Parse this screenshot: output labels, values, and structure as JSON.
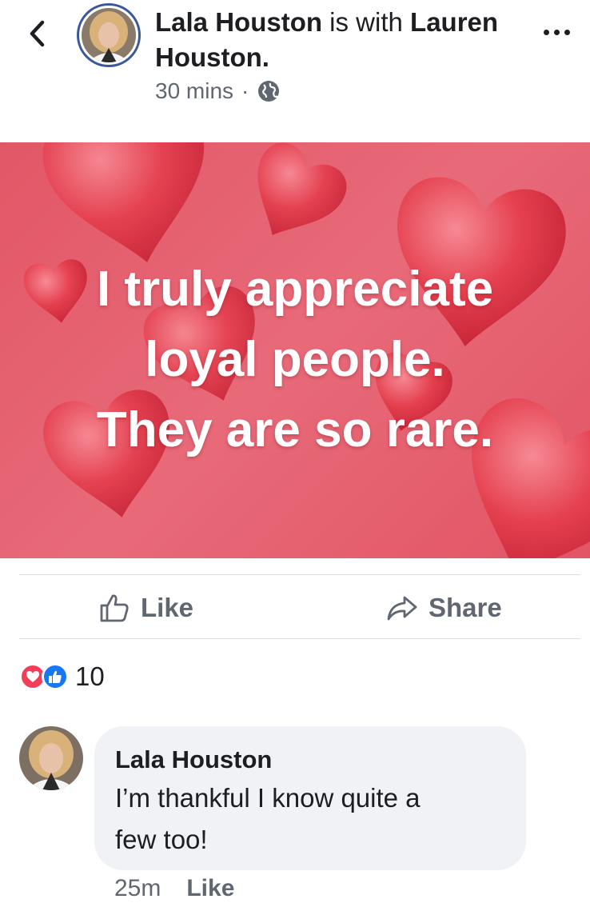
{
  "header": {
    "author": "Lala Houston",
    "with_text": " is with ",
    "tagged": "Lauren Houston.",
    "time": "30 mins",
    "separator": "·",
    "privacy_icon": "globe-icon"
  },
  "post": {
    "quote_line1": "I truly appreciate",
    "quote_line2": "loyal people.",
    "quote_line3": "They are so rare.",
    "background_color": "#e25767"
  },
  "actions": {
    "like_label": "Like",
    "share_label": "Share"
  },
  "reactions": {
    "count": "10",
    "types": [
      "love-reaction-icon",
      "like-reaction-icon"
    ]
  },
  "comment": {
    "author": "Lala Houston",
    "line1": "I’m thankful I know quite a",
    "line2": "few too!",
    "time": "25m",
    "like_label": "Like"
  },
  "colors": {
    "accent": "#3b5998",
    "text": "#1c1e21",
    "muted": "#606770",
    "bubble": "#f0f2f5",
    "love": "#f33e58",
    "like": "#1877f2"
  }
}
